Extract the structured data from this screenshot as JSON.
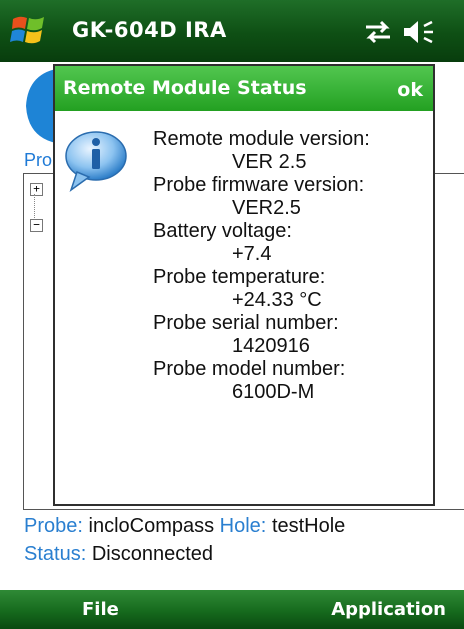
{
  "titlebar": {
    "app_title": "GK-604D IRA",
    "icons": [
      "start-flag-icon",
      "connectivity-icon",
      "volume-icon"
    ]
  },
  "background": {
    "label_partial": "Pro",
    "tree_expand": "+",
    "tree_collapse": "−"
  },
  "dialog": {
    "title": "Remote Module Status",
    "ok_label": "ok",
    "icon": "info-icon",
    "lines": [
      {
        "label": "Remote module version:",
        "value": "VER 2.5"
      },
      {
        "label": "Probe firmware version:",
        "value": "VER2.5"
      },
      {
        "label": "Battery voltage:",
        "value": "+7.4"
      },
      {
        "label": "Probe temperature:",
        "value": "+24.33 °C"
      },
      {
        "label": "Probe serial number:",
        "value": "1420916"
      },
      {
        "label": "Probe model number:",
        "value": "6100D-M"
      }
    ]
  },
  "status": {
    "probe_label": "Probe:",
    "probe_value": "incloCompass",
    "hole_label": "Hole:",
    "hole_value": "testHole",
    "status_label": "Status:",
    "status_value": "Disconnected"
  },
  "menubar": {
    "left": "File",
    "right": "Application"
  },
  "colors": {
    "title_green": "#0e4f14",
    "dialog_green": "#38b237",
    "label_blue": "#2a7fd0"
  }
}
